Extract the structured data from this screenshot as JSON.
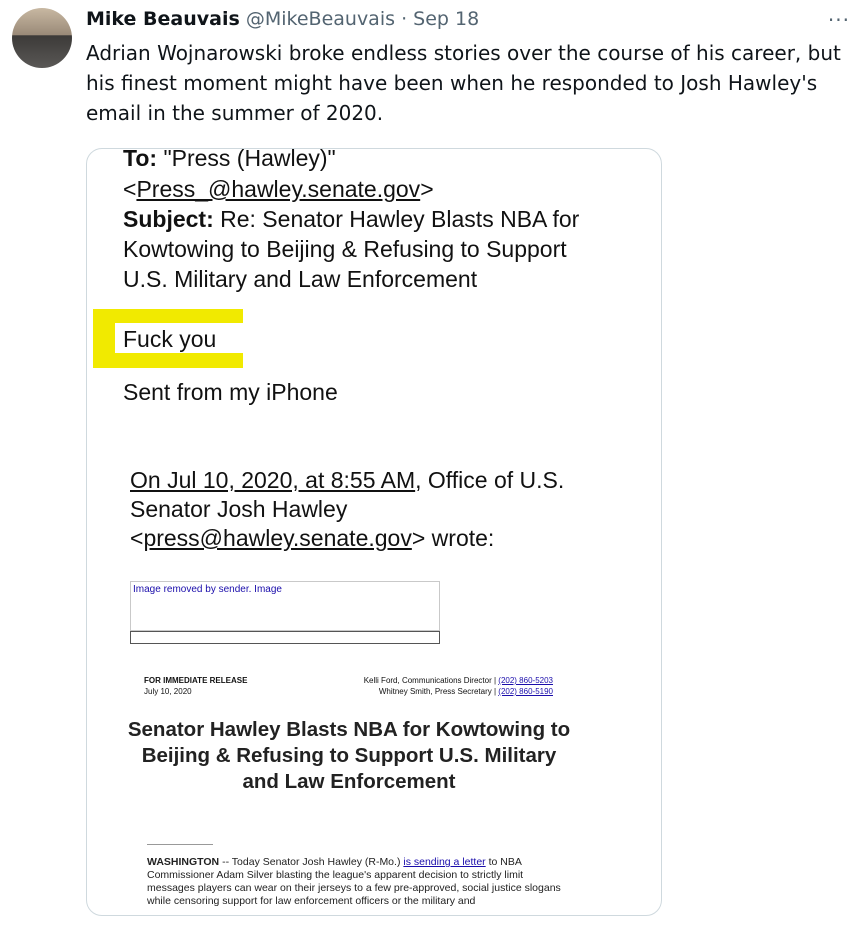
{
  "author": {
    "name": "Mike Beauvais",
    "handle": "@MikeBeauvais",
    "separator": "·",
    "date": "Sep 18"
  },
  "more_label": "···",
  "tweet_text": "Adrian Wojnarowski broke endless stories over the course of his career, but his finest moment might have been when he responded to Josh Hawley's email in the summer of 2020.",
  "image": {
    "to_label": "To:",
    "to_value": " \"Press (Hawley)\"",
    "to_email": "Press_@hawley.senate.gov",
    "subject_label": "Subject:",
    "subject_line1": " Re: Senator Hawley Blasts NBA for",
    "subject_line2": "Kowtowing to Beijing & Refusing to Support",
    "subject_line3": "U.S. Military and Law Enforcement",
    "reply": "Fuck you",
    "signature": "Sent from my iPhone",
    "quote_line1_link": "On Jul 10, 2020, at 8:55 AM",
    "quote_line1_rest": ", Office of U.S.",
    "quote_line2": "Senator Josh Hawley",
    "quote_email": "press@hawley.senate.gov",
    "quote_wrote": " wrote:",
    "removed_image": "Image removed by sender. Image",
    "release_label": "FOR IMMEDIATE RELEASE",
    "release_date": "July 10, 2020",
    "contact1": "Kelli Ford, Communications Director  |  ",
    "contact1_phone": "(202) 860-5203",
    "contact2": "Whitney Smith, Press Secretary  |  ",
    "contact2_phone": "(202) 860-5190",
    "headline": "Senator Hawley Blasts NBA for Kowtowing to Beijing & Refusing to Support U.S. Military and Law Enforcement",
    "body_dateline": "WASHINGTON",
    "body_part1": " -- Today Senator Josh Hawley (R-Mo.) ",
    "body_link": "is sending a letter",
    "body_part2": " to NBA Commissioner Adam Silver blasting the league's apparent decision to strictly limit messages players can wear on their jerseys to a few pre-approved, social justice slogans while censoring support for law enforcement officers or the military and"
  }
}
